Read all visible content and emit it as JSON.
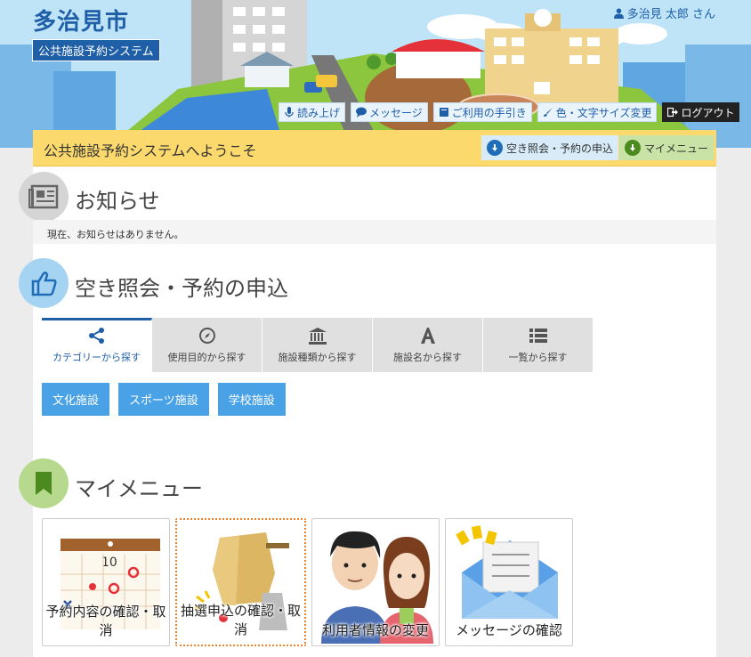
{
  "header": {
    "title": "多治見市",
    "subtitle": "公共施設予約システム",
    "user_name": "多治見 太郎 さん"
  },
  "toolbar": [
    {
      "label": "読み上げ",
      "icon": "microphone-icon"
    },
    {
      "label": "メッセージ",
      "icon": "speech-bubble-icon"
    },
    {
      "label": "ご利用の手引き",
      "icon": "book-icon"
    },
    {
      "label": "色・文字サイズ変更",
      "icon": "brush-icon"
    },
    {
      "label": "ログアウト",
      "icon": "logout-icon"
    }
  ],
  "welcome": {
    "text": "公共施設予約システムへようこそ",
    "jump_reserve": "空き照会・予約の申込",
    "jump_mymenu": "マイメニュー"
  },
  "notice": {
    "title": "お知らせ",
    "message": "現在、お知らせはありません。"
  },
  "reserve": {
    "title": "空き照会・予約の申込",
    "tabs": [
      {
        "label": "カテゴリーから探す",
        "icon": "share-icon",
        "active": true
      },
      {
        "label": "使用目的から探す",
        "icon": "compass-icon",
        "active": false
      },
      {
        "label": "施設種類から探す",
        "icon": "institution-icon",
        "active": false
      },
      {
        "label": "施設名から探す",
        "icon": "font-a-icon",
        "active": false
      },
      {
        "label": "一覧から探す",
        "icon": "list-icon",
        "active": false
      }
    ],
    "categories": [
      "文化施設",
      "スポーツ施設",
      "学校施設"
    ]
  },
  "mymenu": {
    "title": "マイメニュー",
    "cards": [
      {
        "label": "予約内容の確認・取消",
        "icon": "calendar-icon"
      },
      {
        "label": "抽選申込の確認・取消",
        "icon": "lottery-drum-icon"
      },
      {
        "label": "利用者情報の変更",
        "icon": "users-icon"
      },
      {
        "label": "メッセージの確認",
        "icon": "envelope-icon"
      }
    ]
  },
  "colors": {
    "brand_blue": "#1f5fa8",
    "welcome_bar": "#fcd96c",
    "category_button": "#4aa2e6",
    "mymenu_green": "#4b8a1f"
  }
}
